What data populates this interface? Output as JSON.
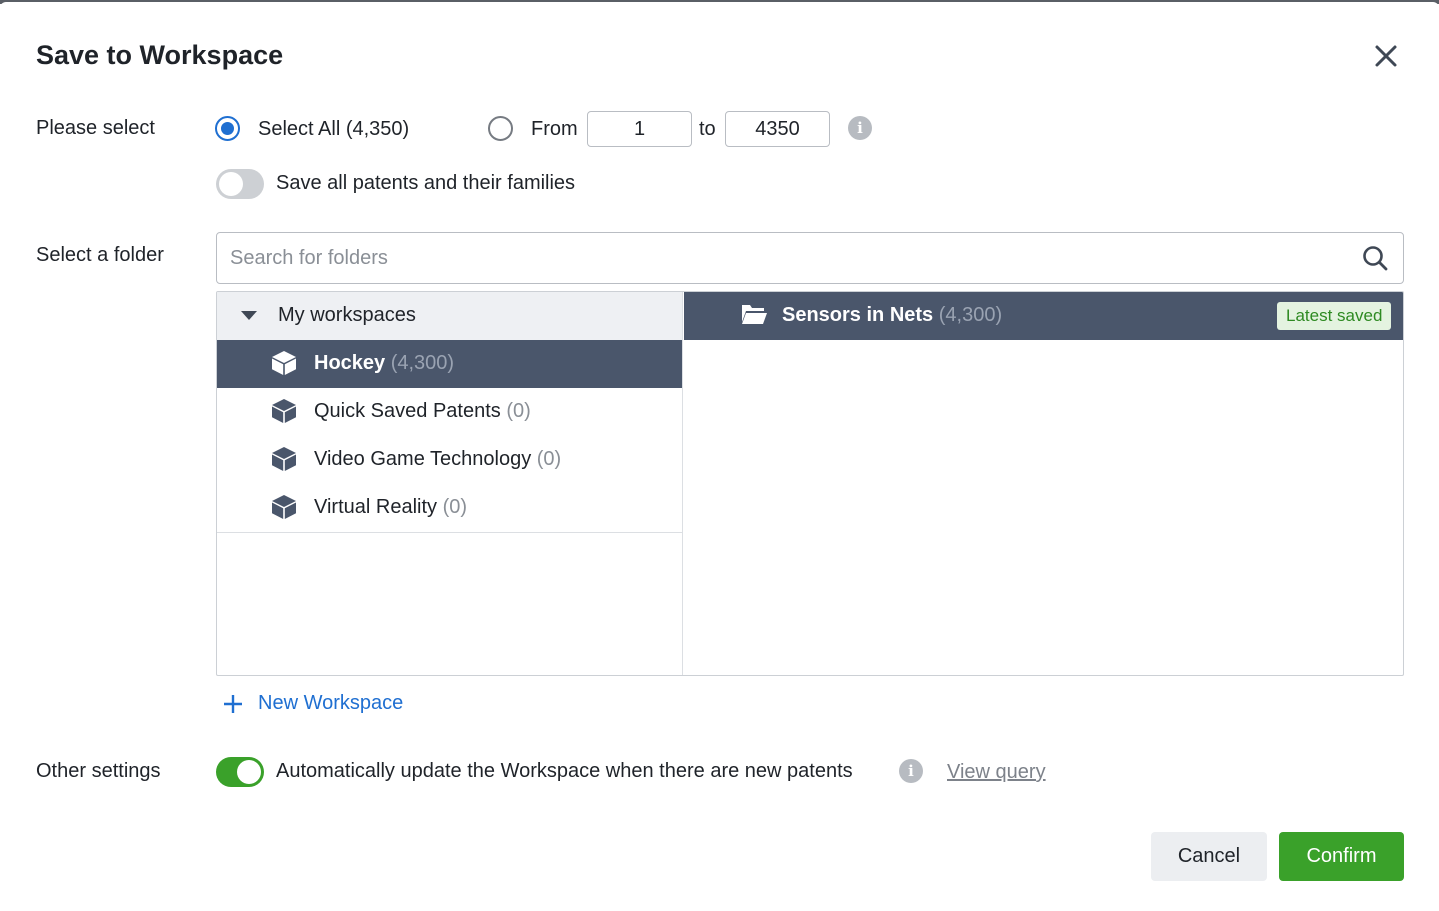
{
  "dialog": {
    "title": "Save to Workspace",
    "close_icon": "close-icon"
  },
  "selection": {
    "label": "Please select",
    "select_all_label": "Select All (4,350)",
    "select_all_checked": true,
    "from_label": "From",
    "from_value": "1",
    "to_label": "to",
    "to_value": "4350",
    "families_toggle_label": "Save all patents and their families",
    "families_toggle_on": false
  },
  "folder": {
    "label": "Select a folder",
    "search_placeholder": "Search for folders",
    "group": {
      "label": "My workspaces",
      "expanded": true
    },
    "workspaces": [
      {
        "name": "Hockey",
        "count": "(4,300)",
        "selected": true
      },
      {
        "name": "Quick Saved Patents",
        "count": "(0)",
        "selected": false
      },
      {
        "name": "Video Game Technology",
        "count": "(0)",
        "selected": false
      },
      {
        "name": "Virtual Reality",
        "count": "(0)",
        "selected": false
      }
    ],
    "subfolders": [
      {
        "name": "Sensors in Nets",
        "count": "(4,300)",
        "badge": "Latest saved"
      }
    ],
    "new_workspace_label": "New Workspace"
  },
  "other": {
    "label": "Other settings",
    "auto_update_label": "Automatically update the Workspace when there are new patents",
    "auto_update_on": true,
    "view_query_label": "View query"
  },
  "footer": {
    "cancel_label": "Cancel",
    "confirm_label": "Confirm"
  },
  "colors": {
    "primary_blue": "#1f6fd1",
    "confirm_green": "#3aa12a",
    "selected_row": "#4a566b",
    "badge_bg": "#e4f3e0",
    "badge_text": "#2e8a22"
  }
}
